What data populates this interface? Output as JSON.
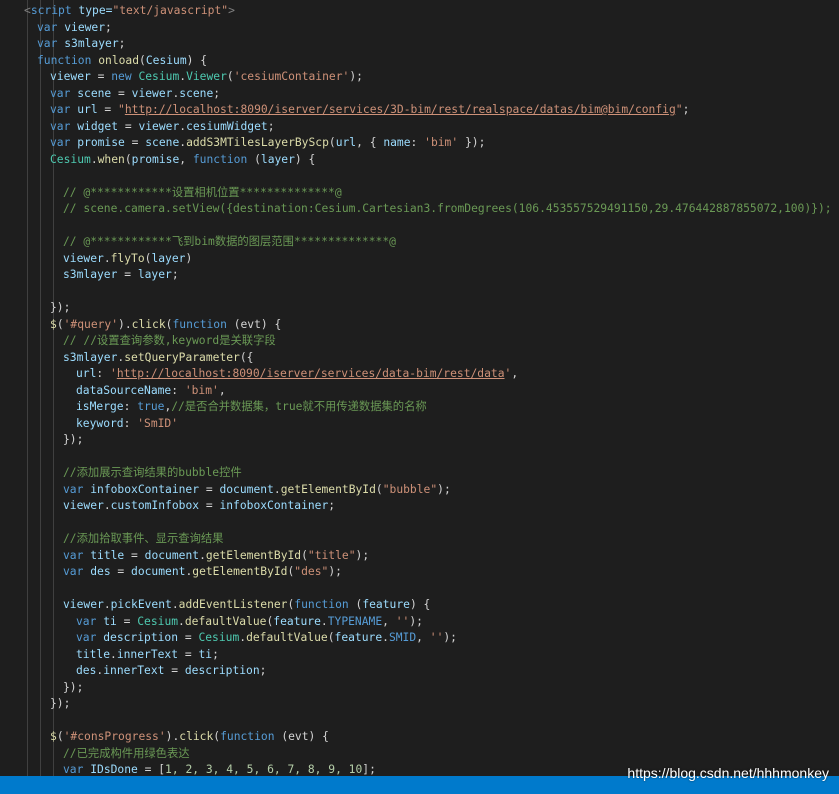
{
  "code": {
    "l1": {
      "a": "<",
      "b": "script",
      "c": " type=",
      "d": "\"text/javascript\"",
      "e": ">"
    },
    "l2": {
      "a": "var ",
      "b": "viewer",
      "c": ";"
    },
    "l3": {
      "a": "var ",
      "b": "s3mlayer",
      "c": ";"
    },
    "l4": {
      "a": "function ",
      "b": "onload",
      "c": "(",
      "d": "Cesium",
      "e": ") {"
    },
    "l5": {
      "a": "viewer",
      "b": " = ",
      "c": "new ",
      "d": "Cesium",
      "e": ".",
      "f": "Viewer",
      "g": "(",
      "h": "'cesiumContainer'",
      "i": ");"
    },
    "l6": {
      "a": "var ",
      "b": "scene",
      "c": " = ",
      "d": "viewer",
      "e": ".",
      "f": "scene",
      "g": ";"
    },
    "l7": {
      "a": "var ",
      "b": "url",
      "c": " = ",
      "d": "\"",
      "e": "http://localhost:8090/iserver/services/3D-bim/rest/realspace/datas/bim@bim/config",
      "f": "\"",
      "g": ";"
    },
    "l8": {
      "a": "var ",
      "b": "widget",
      "c": " = ",
      "d": "viewer",
      "e": ".",
      "f": "cesiumWidget",
      "g": ";"
    },
    "l9": {
      "a": "var ",
      "b": "promise",
      "c": " = ",
      "d": "scene",
      "e": ".",
      "f": "addS3MTilesLayerByScp",
      "g": "(",
      "h": "url",
      "i": ", { ",
      "j": "name",
      "k": ": ",
      "l": "'bim'",
      "m": " });"
    },
    "l10": {
      "a": "Cesium",
      "b": ".",
      "c": "when",
      "d": "(",
      "e": "promise",
      "f": ", ",
      "g": "function ",
      "h": "(",
      "i": "layer",
      "j": ") {"
    },
    "l11": {
      "a": "// @************设置相机位置**************@"
    },
    "l12": {
      "a": "// scene.camera.setView({destination:Cesium.Cartesian3.fromDegrees(106.453557529491150,29.476442887855072,100)});"
    },
    "l13": {
      "a": "// @************飞到bim数据的图层范围**************@"
    },
    "l14": {
      "a": "viewer",
      "b": ".",
      "c": "flyTo",
      "d": "(",
      "e": "layer",
      "f": ")"
    },
    "l15": {
      "a": "s3mlayer",
      "b": " = ",
      "c": "layer",
      "d": ";"
    },
    "l16": {
      "a": "});"
    },
    "l17": {
      "a": "$",
      "b": "(",
      "c": "'#query'",
      "d": ").",
      "e": "click",
      "f": "(",
      "g": "function ",
      "h": "(evt) {"
    },
    "l18": {
      "a": "// //设置查询参数,keyword是关联字段"
    },
    "l19": {
      "a": "s3mlayer",
      "b": ".",
      "c": "setQueryParameter",
      "d": "({"
    },
    "l20": {
      "a": "url",
      "b": ": ",
      "c": "'",
      "d": "http://localhost:8090/iserver/services/data-bim/rest/data",
      "e": "'",
      "f": ","
    },
    "l21": {
      "a": "dataSourceName",
      "b": ": ",
      "c": "'bim'",
      "d": ","
    },
    "l22": {
      "a": "isMerge",
      "b": ": ",
      "c": "true",
      "d": ",",
      "e": "//是否合并数据集，true就不用传递数据集的名称"
    },
    "l23": {
      "a": "keyword",
      "b": ": ",
      "c": "'SmID'"
    },
    "l24": {
      "a": "});"
    },
    "l25": {
      "a": "//添加展示查询结果的bubble控件"
    },
    "l26": {
      "a": "var ",
      "b": "infoboxContainer",
      "c": " = ",
      "d": "document",
      "e": ".",
      "f": "getElementById",
      "g": "(",
      "h": "\"bubble\"",
      "i": ");"
    },
    "l27": {
      "a": "viewer",
      "b": ".",
      "c": "customInfobox",
      "d": " = ",
      "e": "infoboxContainer",
      "f": ";"
    },
    "l28": {
      "a": "//添加拾取事件、显示查询结果"
    },
    "l29": {
      "a": "var ",
      "b": "title",
      "c": " = ",
      "d": "document",
      "e": ".",
      "f": "getElementById",
      "g": "(",
      "h": "\"title\"",
      "i": ");"
    },
    "l30": {
      "a": "var ",
      "b": "des",
      "c": " = ",
      "d": "document",
      "e": ".",
      "f": "getElementById",
      "g": "(",
      "h": "\"des\"",
      "i": ");"
    },
    "l31": {
      "a": "viewer",
      "b": ".",
      "c": "pickEvent",
      "d": ".",
      "e": "addEventListener",
      "f": "(",
      "g": "function ",
      "h": "(",
      "i": "feature",
      "j": ") {"
    },
    "l32": {
      "a": "var ",
      "b": "ti",
      "c": " = ",
      "d": "Cesium",
      "e": ".",
      "f": "defaultValue",
      "g": "(",
      "h": "feature",
      "i": ".",
      "j": "TYPENAME",
      "k": ", ",
      "l": "''",
      "m": ");"
    },
    "l33": {
      "a": "var ",
      "b": "description",
      "c": " = ",
      "d": "Cesium",
      "e": ".",
      "f": "defaultValue",
      "g": "(",
      "h": "feature",
      "i": ".",
      "j": "SMID",
      "k": ", ",
      "l": "''",
      "m": ");"
    },
    "l34": {
      "a": "title",
      "b": ".",
      "c": "innerText",
      "d": " = ",
      "e": "ti",
      "f": ";"
    },
    "l35": {
      "a": "des",
      "b": ".",
      "c": "innerText",
      "d": " = ",
      "e": "description",
      "f": ";"
    },
    "l36": {
      "a": "});"
    },
    "l37": {
      "a": "});"
    },
    "l38": {
      "a": "$",
      "b": "(",
      "c": "'#consProgress'",
      "d": ").",
      "e": "click",
      "f": "(",
      "g": "function ",
      "h": "(evt) {"
    },
    "l39": {
      "a": "//已完成构件用绿色表达"
    },
    "l40": {
      "a": "var ",
      "b": "IDsDone",
      "c": " = [",
      "d": "1, 2, 3, 4, 5, 6, 7, 8, 9, 10",
      "e": "];"
    }
  },
  "watermark": "https://blog.csdn.net/hhhmonkey",
  "colors": {
    "background": "#1e1e1e",
    "statusbar": "#007acc",
    "keyword": "#569cd6",
    "string": "#ce9178",
    "comment": "#6a9955",
    "function": "#dcdcaa",
    "variable": "#9cdcfe"
  }
}
